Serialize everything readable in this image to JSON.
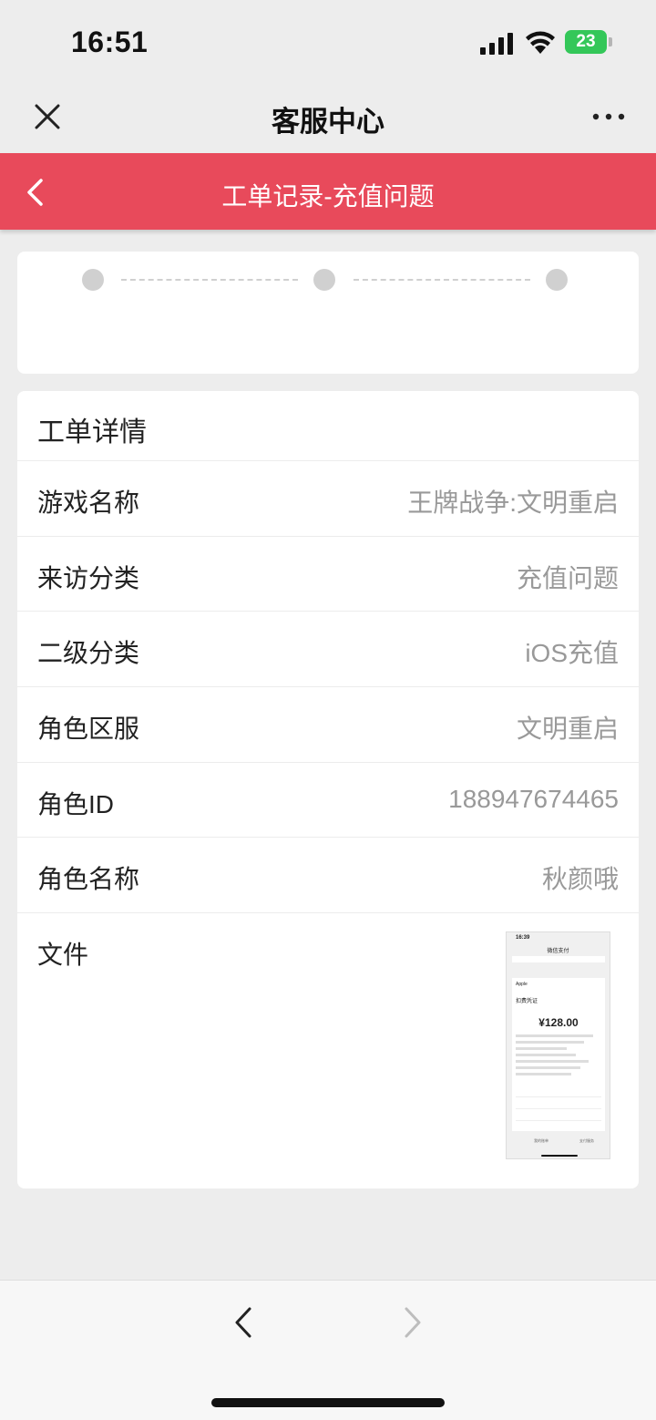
{
  "status_bar": {
    "time": "16:51",
    "battery": "23"
  },
  "nav": {
    "title": "客服中心",
    "close_icon": "close-icon",
    "more_icon": "more-icon"
  },
  "header": {
    "title": "工单记录-充值问题",
    "back_icon": "chevron-left-icon",
    "color": "#e84a5b"
  },
  "progress": {
    "steps": 3
  },
  "detail": {
    "title": "工单详情",
    "rows": [
      {
        "label": "游戏名称",
        "value": "王牌战争:文明重启"
      },
      {
        "label": "来访分类",
        "value": "充值问题"
      },
      {
        "label": "二级分类",
        "value": "iOS充值"
      },
      {
        "label": "角色区服",
        "value": "文明重启"
      },
      {
        "label": "角色ID",
        "value": "188947674465"
      },
      {
        "label": "角色名称",
        "value": "秋颜哦"
      }
    ],
    "file_label": "文件",
    "thumbnail": {
      "time": "16:39",
      "header": "微信支付",
      "apple": "Apple",
      "receipt_label": "扣费凭证",
      "amount": "¥128.00",
      "foot_left": "我的账单",
      "foot_right": "支付服务"
    }
  },
  "bottom_bar": {
    "back_icon": "chevron-left-icon",
    "forward_icon": "chevron-right-icon"
  }
}
